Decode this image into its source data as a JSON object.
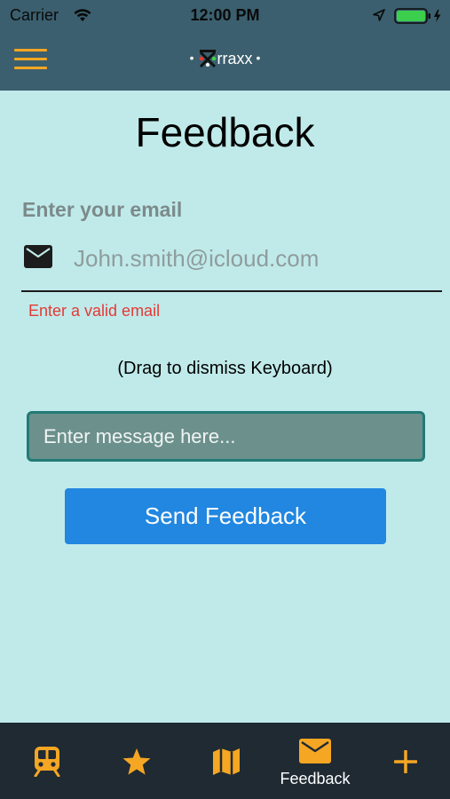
{
  "status_bar": {
    "carrier": "Carrier",
    "time": "12:00 PM",
    "icons": [
      "wifi-icon",
      "location-arrow-icon",
      "battery-icon"
    ]
  },
  "nav_bar": {
    "menu_icon": "hamburger-menu-icon",
    "logo_text": "rraxx",
    "logo_dots": "•"
  },
  "page": {
    "title": "Feedback",
    "email_label": "Enter your email",
    "email_icon": "envelope-icon",
    "email_placeholder": "John.smith@icloud.com",
    "email_value": "",
    "email_error": "Enter a valid email",
    "drag_hint": "(Drag to dismiss Keyboard)",
    "message_placeholder": "Enter message here...",
    "message_value": "",
    "send_label": "Send Feedback"
  },
  "tabs": [
    {
      "icon": "train-icon",
      "label": ""
    },
    {
      "icon": "star-icon",
      "label": ""
    },
    {
      "icon": "map-icon",
      "label": ""
    },
    {
      "icon": "envelope-icon",
      "label": "Feedback",
      "active": true
    },
    {
      "icon": "plus-icon",
      "label": ""
    }
  ],
  "colors": {
    "nav_background": "#3b5f6e",
    "page_background": "#c0eaea",
    "accent": "#f5a623",
    "error": "#e53935",
    "button": "#2187e0",
    "tab_bar": "#1f2a33",
    "message_field": "#6c918d"
  }
}
